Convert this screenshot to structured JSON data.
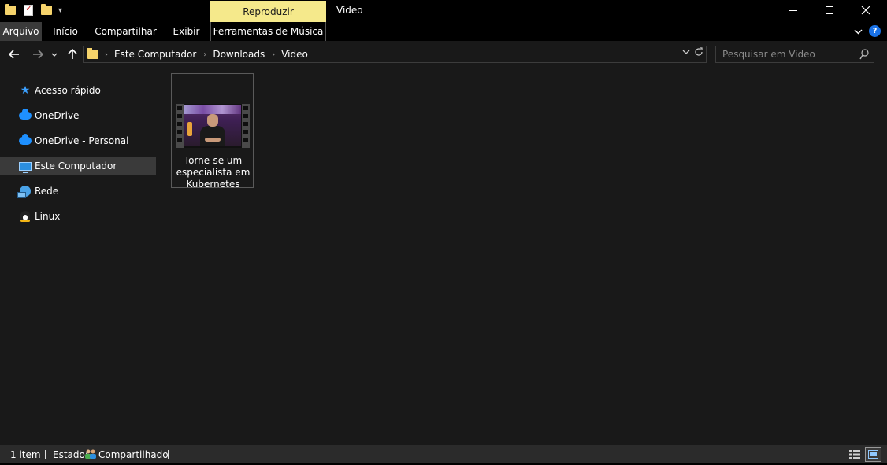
{
  "window": {
    "title": "Video",
    "minimize_icon": "minimize-icon",
    "maximize_icon": "maximize-icon",
    "close_icon": "close-icon"
  },
  "quick_access_toolbar": {
    "icons": [
      "folder-icon",
      "properties-icon",
      "new-folder-icon",
      "customize-dropdown-icon"
    ]
  },
  "ribbon": {
    "context_group_label": "Reproduzir",
    "tabs": [
      {
        "label": "Arquivo",
        "active": true
      },
      {
        "label": "Início"
      },
      {
        "label": "Compartilhar"
      },
      {
        "label": "Exibir"
      },
      {
        "label": "Ferramentas de Música"
      }
    ],
    "help_label": "?"
  },
  "address_bar": {
    "breadcrumbs": [
      "Este Computador",
      "Downloads",
      "Video"
    ]
  },
  "search": {
    "placeholder": "Pesquisar em Video"
  },
  "sidebar": {
    "items": [
      {
        "label": "Acesso rápido",
        "icon": "star-icon"
      },
      {
        "label": "OneDrive",
        "icon": "cloud-icon"
      },
      {
        "label": "OneDrive - Personal",
        "icon": "cloud-icon"
      },
      {
        "label": "Este Computador",
        "icon": "computer-icon",
        "selected": true
      },
      {
        "label": "Rede",
        "icon": "network-icon"
      },
      {
        "label": "Linux",
        "icon": "linux-icon"
      }
    ]
  },
  "files": [
    {
      "name": "Torne-se um especialista em Kubernetes",
      "type": "video",
      "icon": "video-thumbnail"
    }
  ],
  "status_bar": {
    "item_count": "1 item",
    "state_label": "Estado:",
    "state_value": "Compartilhado"
  },
  "colors": {
    "background": "#191919",
    "titlebar": "#000000",
    "context_tab": "#f5e98b",
    "selection": "#3a3a3a",
    "accent": "#1e90ff"
  }
}
